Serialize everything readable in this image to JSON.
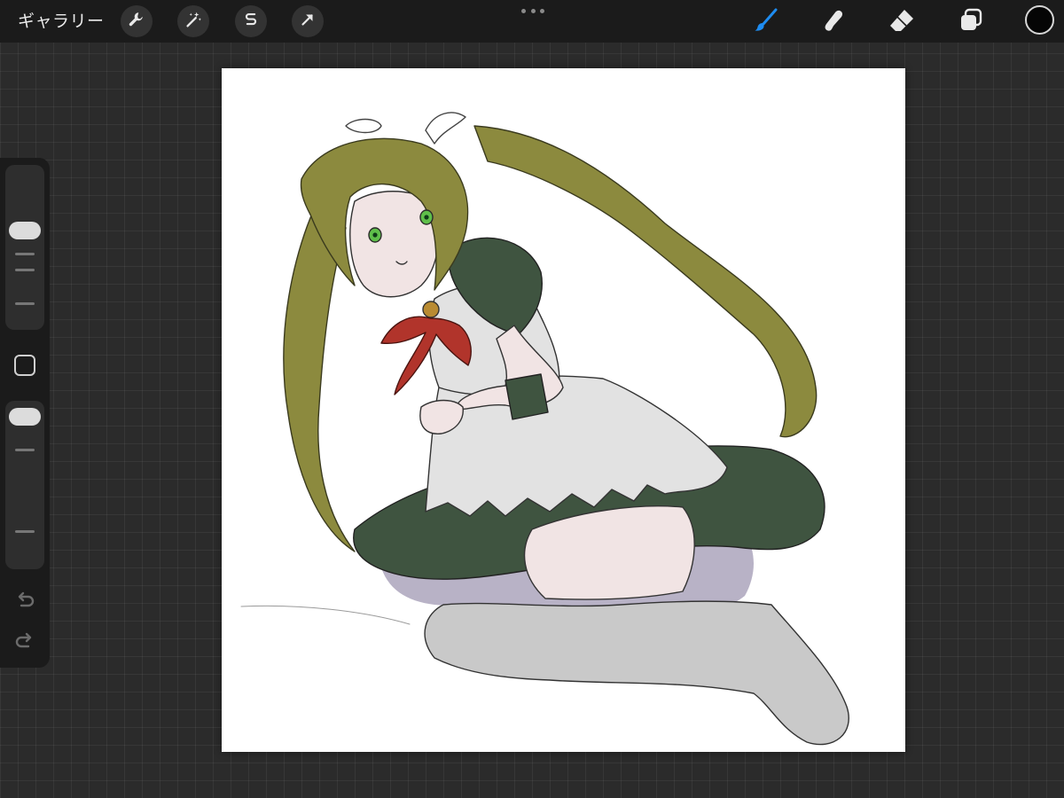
{
  "app": {
    "gallery_label": "ギャラリー"
  },
  "toolbar": {
    "left_tools": [
      {
        "name": "actions",
        "icon": "wrench-icon"
      },
      {
        "name": "adjustments",
        "icon": "magic-wand-icon"
      },
      {
        "name": "selection",
        "icon": "selection-s-icon"
      },
      {
        "name": "transform",
        "icon": "arrow-cursor-icon"
      }
    ],
    "right_tools": [
      {
        "name": "brush",
        "icon": "brush-icon",
        "active": true
      },
      {
        "name": "smudge",
        "icon": "smudge-finger-icon",
        "active": false
      },
      {
        "name": "eraser",
        "icon": "eraser-icon",
        "active": false
      },
      {
        "name": "layers",
        "icon": "layers-icon",
        "active": false
      }
    ],
    "active_color": "#050505",
    "accent_color": "#1e8cf0"
  },
  "sidebar": {
    "brush_size_level": 0.15,
    "opacity_level": 0.06
  },
  "colors": {
    "hair": "#8c8a3e",
    "dress": "#3f5440",
    "apron": "#e2e2e2",
    "bow": "#b1342b",
    "stockings": "#c9c9c9",
    "petticoat": "#b8b2c6",
    "skin": "#f1e4e4"
  }
}
